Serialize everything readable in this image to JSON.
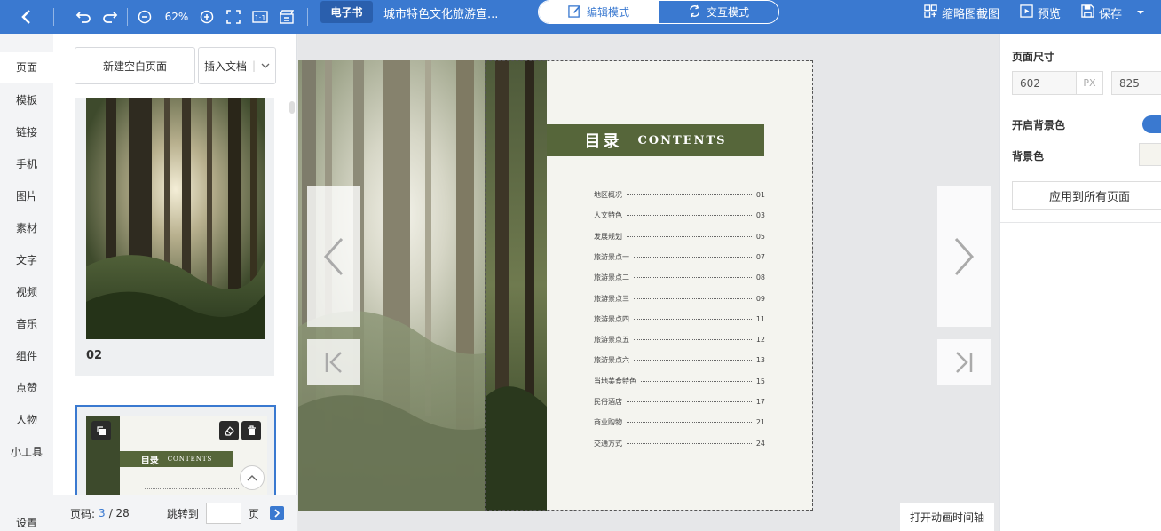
{
  "topbar": {
    "zoom": "62%",
    "ebook_tag": "电子书",
    "doc_title": "城市特色文化旅游宣...",
    "mode_edit": "编辑模式",
    "mode_interactive": "交互模式",
    "screenshot": "缩略图截图",
    "preview": "预览",
    "save": "保存",
    "accent": "#3a79d0"
  },
  "sidenav": {
    "items": [
      "页面",
      "模板",
      "链接",
      "手机",
      "图片",
      "素材",
      "文字",
      "视频",
      "音乐",
      "组件",
      "点赞",
      "人物",
      "小工具"
    ],
    "settings": "设置"
  },
  "pagepanel": {
    "new_blank": "新建空白页面",
    "insert_doc": "插入文档",
    "thumb1_num": "02",
    "pager_label": "页码:",
    "current": "3",
    "total": "/ 28",
    "jump_label": "跳转到",
    "jump_value": "",
    "page_unit": "页"
  },
  "page": {
    "toc_cn": "目录",
    "toc_en": "CONTENTS",
    "toc_color": "#56663a",
    "toc": [
      {
        "t": "地区概况",
        "p": "01"
      },
      {
        "t": "人文特色",
        "p": "03"
      },
      {
        "t": "发展规划",
        "p": "05"
      },
      {
        "t": "旅游景点一",
        "p": "07"
      },
      {
        "t": "旅游景点二",
        "p": "08"
      },
      {
        "t": "旅游景点三",
        "p": "09"
      },
      {
        "t": "旅游景点四",
        "p": "11"
      },
      {
        "t": "旅游景点五",
        "p": "12"
      },
      {
        "t": "旅游景点六",
        "p": "13"
      },
      {
        "t": "当地美食特色",
        "p": "15"
      },
      {
        "t": "民俗酒店",
        "p": "17"
      },
      {
        "t": "商业购物",
        "p": "21"
      },
      {
        "t": "交通方式",
        "p": "24"
      }
    ]
  },
  "canvas": {
    "timeline_btn": "打开动画时间轴"
  },
  "rightpanel": {
    "page_size": "页面尺寸",
    "width": "602",
    "unit": "PX",
    "height": "825",
    "bg_enable": "开启背景色",
    "bg_color": "背景色",
    "apply_all": "应用到所有页面"
  }
}
